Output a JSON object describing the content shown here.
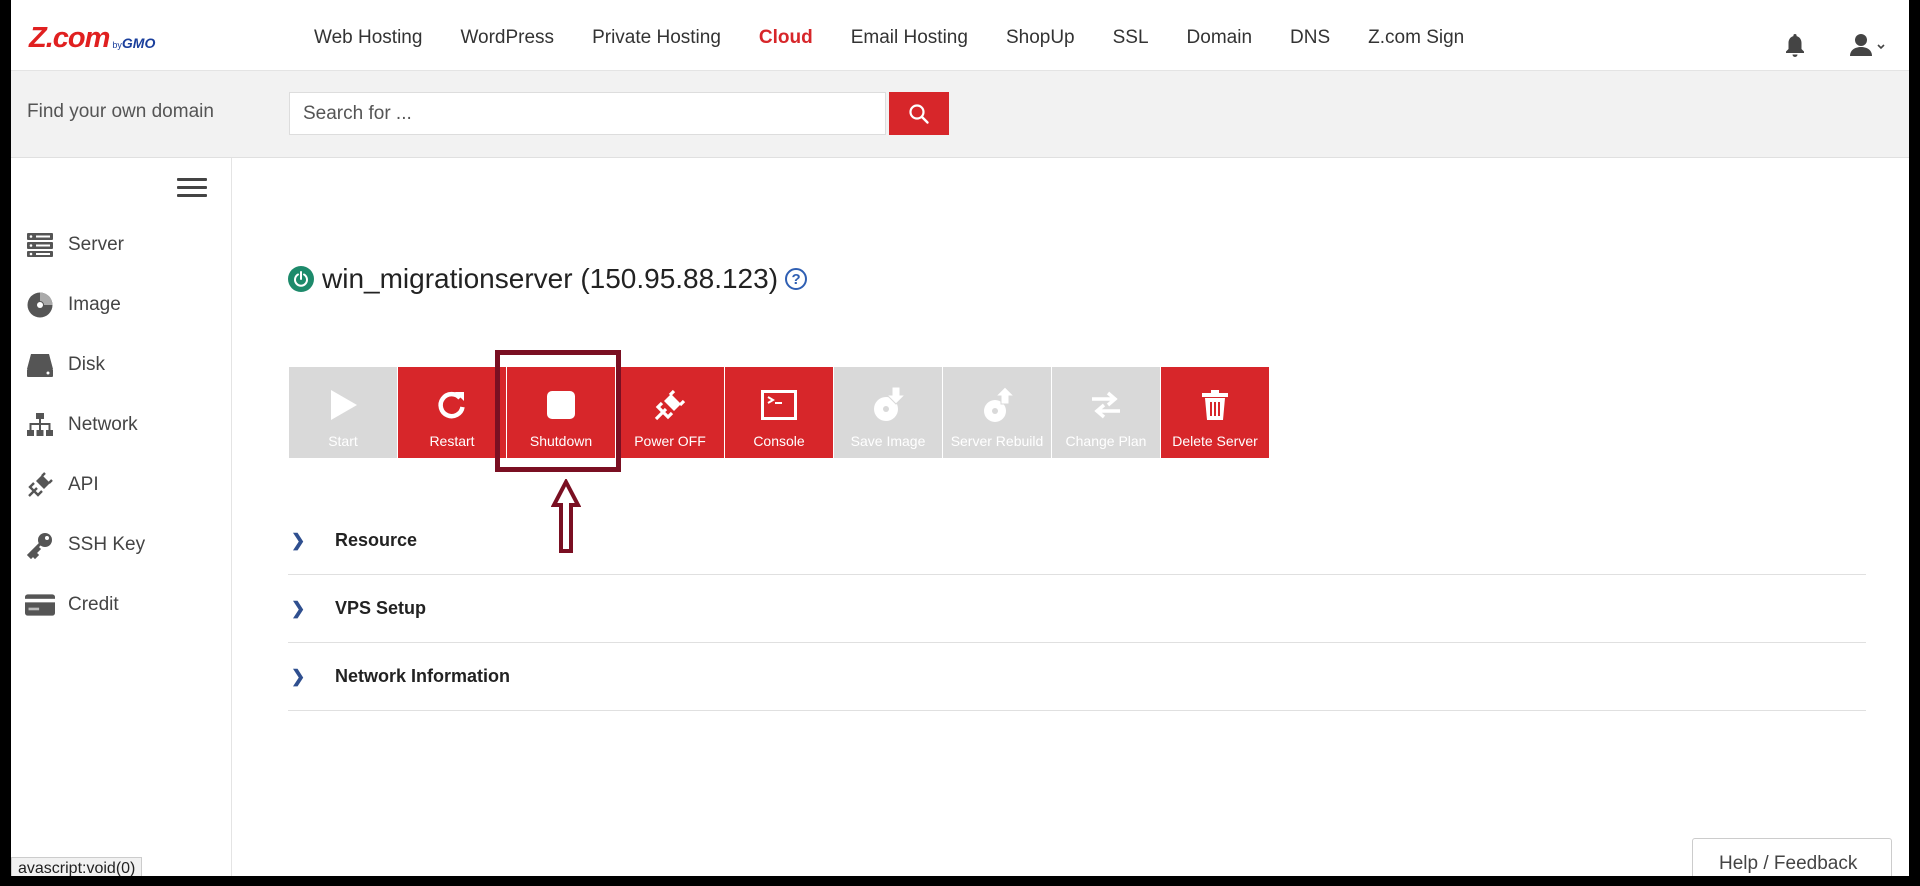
{
  "brand": {
    "name": "Z.com",
    "by": "by",
    "parent": "GMO",
    "primary_color": "#d7262a",
    "secondary_color": "#1a3f9c"
  },
  "nav": {
    "items": [
      "Web Hosting",
      "WordPress",
      "Private Hosting",
      "Cloud",
      "Email Hosting",
      "ShopUp",
      "SSL",
      "Domain",
      "DNS",
      "Z.com Sign"
    ],
    "active": "Cloud"
  },
  "search": {
    "label": "Find your own domain",
    "placeholder": "Search for ..."
  },
  "sidebar": {
    "items": [
      {
        "label": "Server",
        "icon": "server-icon"
      },
      {
        "label": "Image",
        "icon": "disc-icon"
      },
      {
        "label": "Disk",
        "icon": "disk-icon"
      },
      {
        "label": "Network",
        "icon": "network-icon"
      },
      {
        "label": "API",
        "icon": "plug-icon"
      },
      {
        "label": "SSH Key",
        "icon": "key-icon"
      },
      {
        "label": "Credit",
        "icon": "credit-card-icon"
      }
    ]
  },
  "server": {
    "title": "win_migrationserver (150.95.88.123)",
    "status": "running",
    "status_color": "#1d8a6b"
  },
  "toolbar": {
    "buttons": [
      {
        "label": "Start",
        "enabled": false,
        "icon": "play-icon"
      },
      {
        "label": "Restart",
        "enabled": true,
        "icon": "restart-icon"
      },
      {
        "label": "Shutdown",
        "enabled": true,
        "icon": "stop-icon"
      },
      {
        "label": "Power OFF",
        "enabled": true,
        "icon": "power-plug-icon"
      },
      {
        "label": "Console",
        "enabled": true,
        "icon": "console-icon"
      },
      {
        "label": "Save Image",
        "enabled": false,
        "icon": "save-image-icon"
      },
      {
        "label": "Server Rebuild",
        "enabled": false,
        "icon": "rebuild-icon"
      },
      {
        "label": "Change Plan",
        "enabled": false,
        "icon": "swap-icon"
      },
      {
        "label": "Delete Server",
        "enabled": true,
        "icon": "trash-icon"
      }
    ],
    "highlighted": "Shutdown",
    "highlight_color": "#7a0f22"
  },
  "sections": [
    {
      "label": "Resource"
    },
    {
      "label": "VPS Setup"
    },
    {
      "label": "Network Information"
    }
  ],
  "help_feedback": "Help / Feedback",
  "statusbar": "avascript:void(0)"
}
